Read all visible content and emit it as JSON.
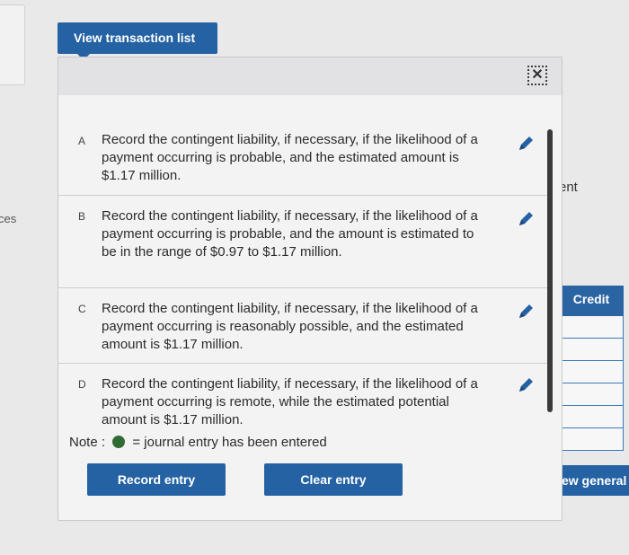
{
  "background": {
    "left_text": "ces",
    "right_text": "ent",
    "credit_header": "Credit",
    "view_general_label": "View general"
  },
  "tab": {
    "label": "View transaction list"
  },
  "modal": {
    "close_icon": "close-icon",
    "items": [
      {
        "letter": "A",
        "text": "Record the contingent liability, if necessary, if the likelihood of a payment occurring is probable, and the estimated amount is $1.17 million."
      },
      {
        "letter": "B",
        "text": "Record the contingent liability, if necessary, if the likelihood of a payment occurring is probable, and the amount is estimated to be in the range of $0.97 to $1.17 million."
      },
      {
        "letter": "C",
        "text": "Record the contingent liability, if necessary, if the likelihood of a payment occurring is reasonably possible, and the estimated amount is $1.17 million."
      },
      {
        "letter": "D",
        "text": "Record the contingent liability, if necessary, if the likelihood of a payment occurring is remote, while the estimated potential amount is $1.17 million."
      }
    ],
    "note_prefix": "Note :",
    "note_suffix": "= journal entry has been entered",
    "record_entry_label": "Record entry",
    "clear_entry_label": "Clear entry"
  },
  "colors": {
    "accent": "#2562a3",
    "entered_dot": "#2f6b33"
  }
}
